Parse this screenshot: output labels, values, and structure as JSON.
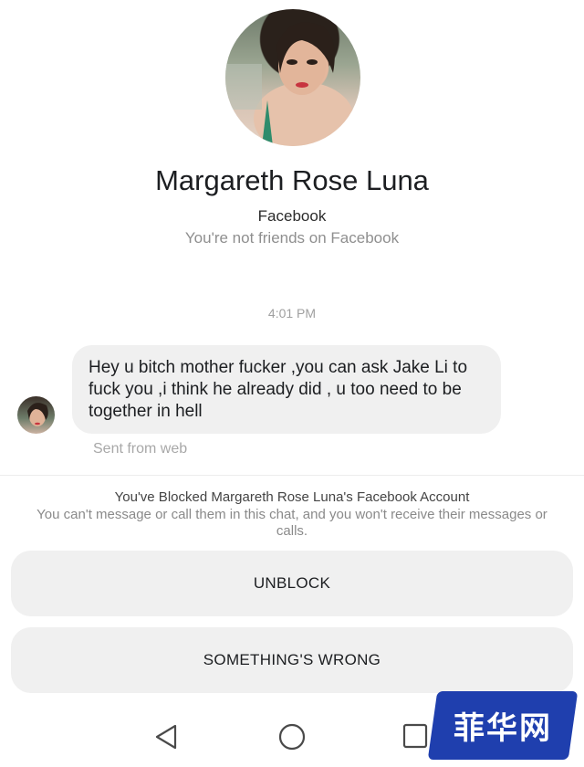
{
  "profile": {
    "name": "Margareth Rose Luna",
    "platform": "Facebook",
    "friend_status": "You're not friends on Facebook"
  },
  "conversation": {
    "timestamp": "4:01 PM",
    "messages": [
      {
        "text": "Hey u bitch mother fucker ,you can ask Jake Li to fuck you ,i think he already did , u too need to be together in hell",
        "meta": "Sent from web"
      }
    ]
  },
  "blocked_panel": {
    "title": "You've Blocked Margareth Rose Luna's Facebook Account",
    "description": "You can't message or call them in this chat, and you won't receive their messages or calls.",
    "unblock_label": "UNBLOCK",
    "something_wrong_label": "SOMETHING'S WRONG"
  },
  "system_nav": {
    "icons": [
      "back-icon",
      "home-icon",
      "recents-icon"
    ]
  },
  "watermark": {
    "text": "菲华网"
  },
  "colors": {
    "bubble": "#f0f0f0",
    "button": "#f0f0f0",
    "muted_text": "#8f8f8f",
    "watermark": "#1f3fae"
  }
}
